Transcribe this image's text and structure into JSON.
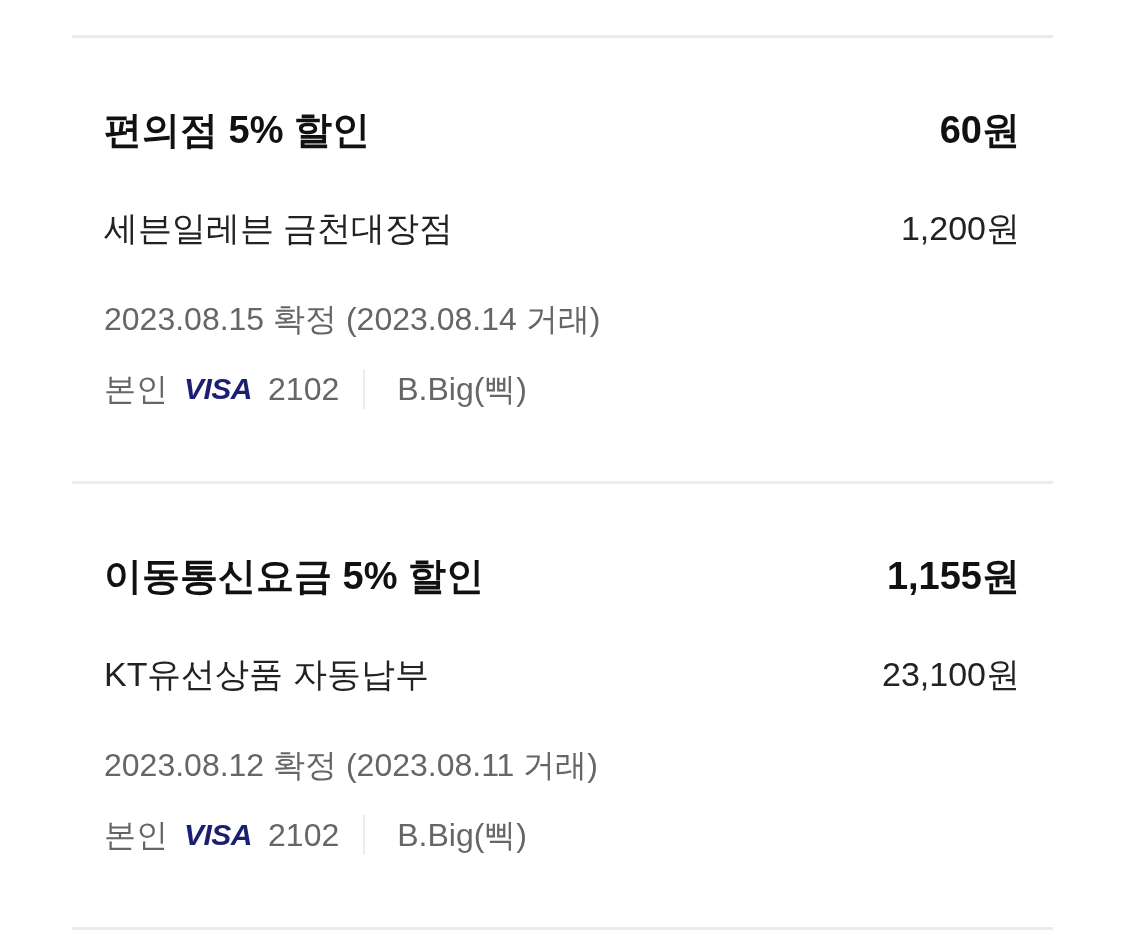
{
  "transactions": [
    {
      "title": "편의점 5% 할인",
      "discount": "60원",
      "merchant": "세븐일레븐 금천대장점",
      "amount": "1,200원",
      "dates": "2023.08.15 확정 (2023.08.14 거래)",
      "holder": "본인",
      "card_brand": "VISA",
      "card_number": "2102",
      "card_name": "B.Big(삑)"
    },
    {
      "title": "이동통신요금 5% 할인",
      "discount": "1,155원",
      "merchant": "KT유선상품 자동납부",
      "amount": "23,100원",
      "dates": "2023.08.12 확정 (2023.08.11 거래)",
      "holder": "본인",
      "card_brand": "VISA",
      "card_number": "2102",
      "card_name": "B.Big(삑)"
    }
  ]
}
